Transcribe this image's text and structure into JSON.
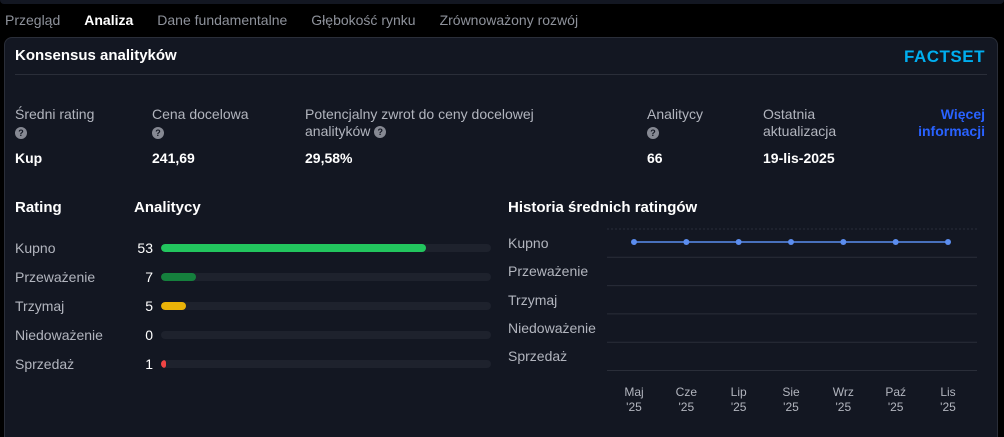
{
  "tabs": [
    {
      "label": "Przegląd",
      "active": false
    },
    {
      "label": "Analiza",
      "active": true
    },
    {
      "label": "Dane fundamentalne",
      "active": false
    },
    {
      "label": "Głębokość rynku",
      "active": false
    },
    {
      "label": "Zrównoważony rozwój",
      "active": false
    }
  ],
  "card": {
    "title": "Konsensus analityków",
    "provider": "FACTSET",
    "more_info": "Więcej informacji"
  },
  "stats": [
    {
      "label": "Średni rating",
      "value": "Kup"
    },
    {
      "label": "Cena docelowa",
      "value": "241,69"
    },
    {
      "label": "Potencjalny zwrot do ceny docelowej analityków",
      "value": "29,58%"
    },
    {
      "label": "Analitycy",
      "value": "66"
    },
    {
      "label": "Ostatnia aktualizacja",
      "value": "19-lis-2025"
    }
  ],
  "help_icon_glyph": "?",
  "ratings": {
    "header_rating": "Rating",
    "header_analysts": "Analitycy",
    "max": 66,
    "rows": [
      {
        "name": "Kupno",
        "count": "53",
        "value": 53,
        "color": "#22c55e"
      },
      {
        "name": "Przeważenie",
        "count": "7",
        "value": 7,
        "color": "#15803d"
      },
      {
        "name": "Trzymaj",
        "count": "5",
        "value": 5,
        "color": "#eab308"
      },
      {
        "name": "Niedoważenie",
        "count": "0",
        "value": 0,
        "color": "#7f1d1d"
      },
      {
        "name": "Sprzedaż",
        "count": "1",
        "value": 1,
        "color": "#ef4444"
      }
    ]
  },
  "chart_data": {
    "type": "line",
    "title": "Historia średnich ratingów",
    "categories": [
      "Kupno",
      "Przeważenie",
      "Trzymaj",
      "Niedoważenie",
      "Sprzedaż"
    ],
    "x": [
      "Maj '25",
      "Cze '25",
      "Lip '25",
      "Sie '25",
      "Wrz '25",
      "Paź '25",
      "Lis '25"
    ],
    "x_lines": [
      [
        "Maj",
        "'25"
      ],
      [
        "Cze",
        "'25"
      ],
      [
        "Lip",
        "'25"
      ],
      [
        "Sie",
        "'25"
      ],
      [
        "Wrz",
        "'25"
      ],
      [
        "Paź",
        "'25"
      ],
      [
        "Lis",
        "'25"
      ]
    ],
    "series": [
      {
        "values": [
          "Kupno",
          "Kupno",
          "Kupno",
          "Kupno",
          "Kupno",
          "Kupno",
          "Kupno"
        ],
        "color": "#5b8def"
      }
    ],
    "grid": true
  }
}
